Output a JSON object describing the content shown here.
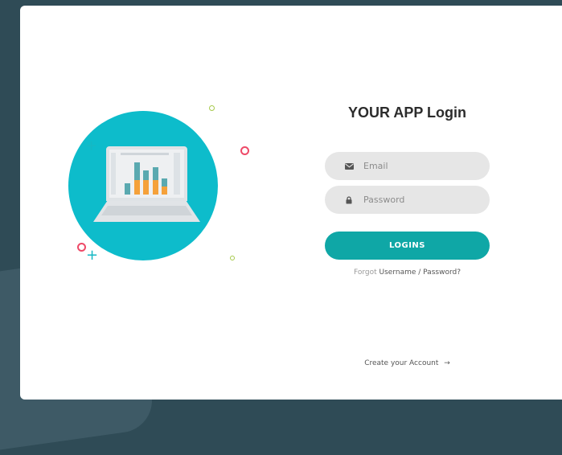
{
  "login": {
    "title": "YOUR APP Login",
    "email_placeholder": "Email",
    "password_placeholder": "Password",
    "submit_label": "LOGINS",
    "forgot_prefix": "Forgot",
    "forgot_link": "Username / Password?",
    "create_account": "Create your Account",
    "create_arrow": "→"
  },
  "icons": {
    "email": "envelope-icon",
    "password": "lock-icon"
  },
  "illustration": {
    "name": "laptop-with-bar-chart",
    "bars": [
      {
        "teal": 0.35,
        "orange": 0.0
      },
      {
        "teal": 0.55,
        "orange": 0.45
      },
      {
        "teal": 0.3,
        "orange": 0.45
      },
      {
        "teal": 0.4,
        "orange": 0.45
      },
      {
        "teal": 0.25,
        "orange": 0.25
      }
    ]
  },
  "colors": {
    "background": "#2f4b56",
    "card": "#ffffff",
    "accent": "#0fa7a6",
    "illustration_circle": "#0dbccb",
    "field_bg": "#e6e6e6",
    "bar_teal": "#5aa9b0",
    "bar_orange": "#f5a13a",
    "deco_pink": "#ee4a68",
    "deco_teal": "#15b8c4",
    "deco_green": "#a6c94a"
  }
}
